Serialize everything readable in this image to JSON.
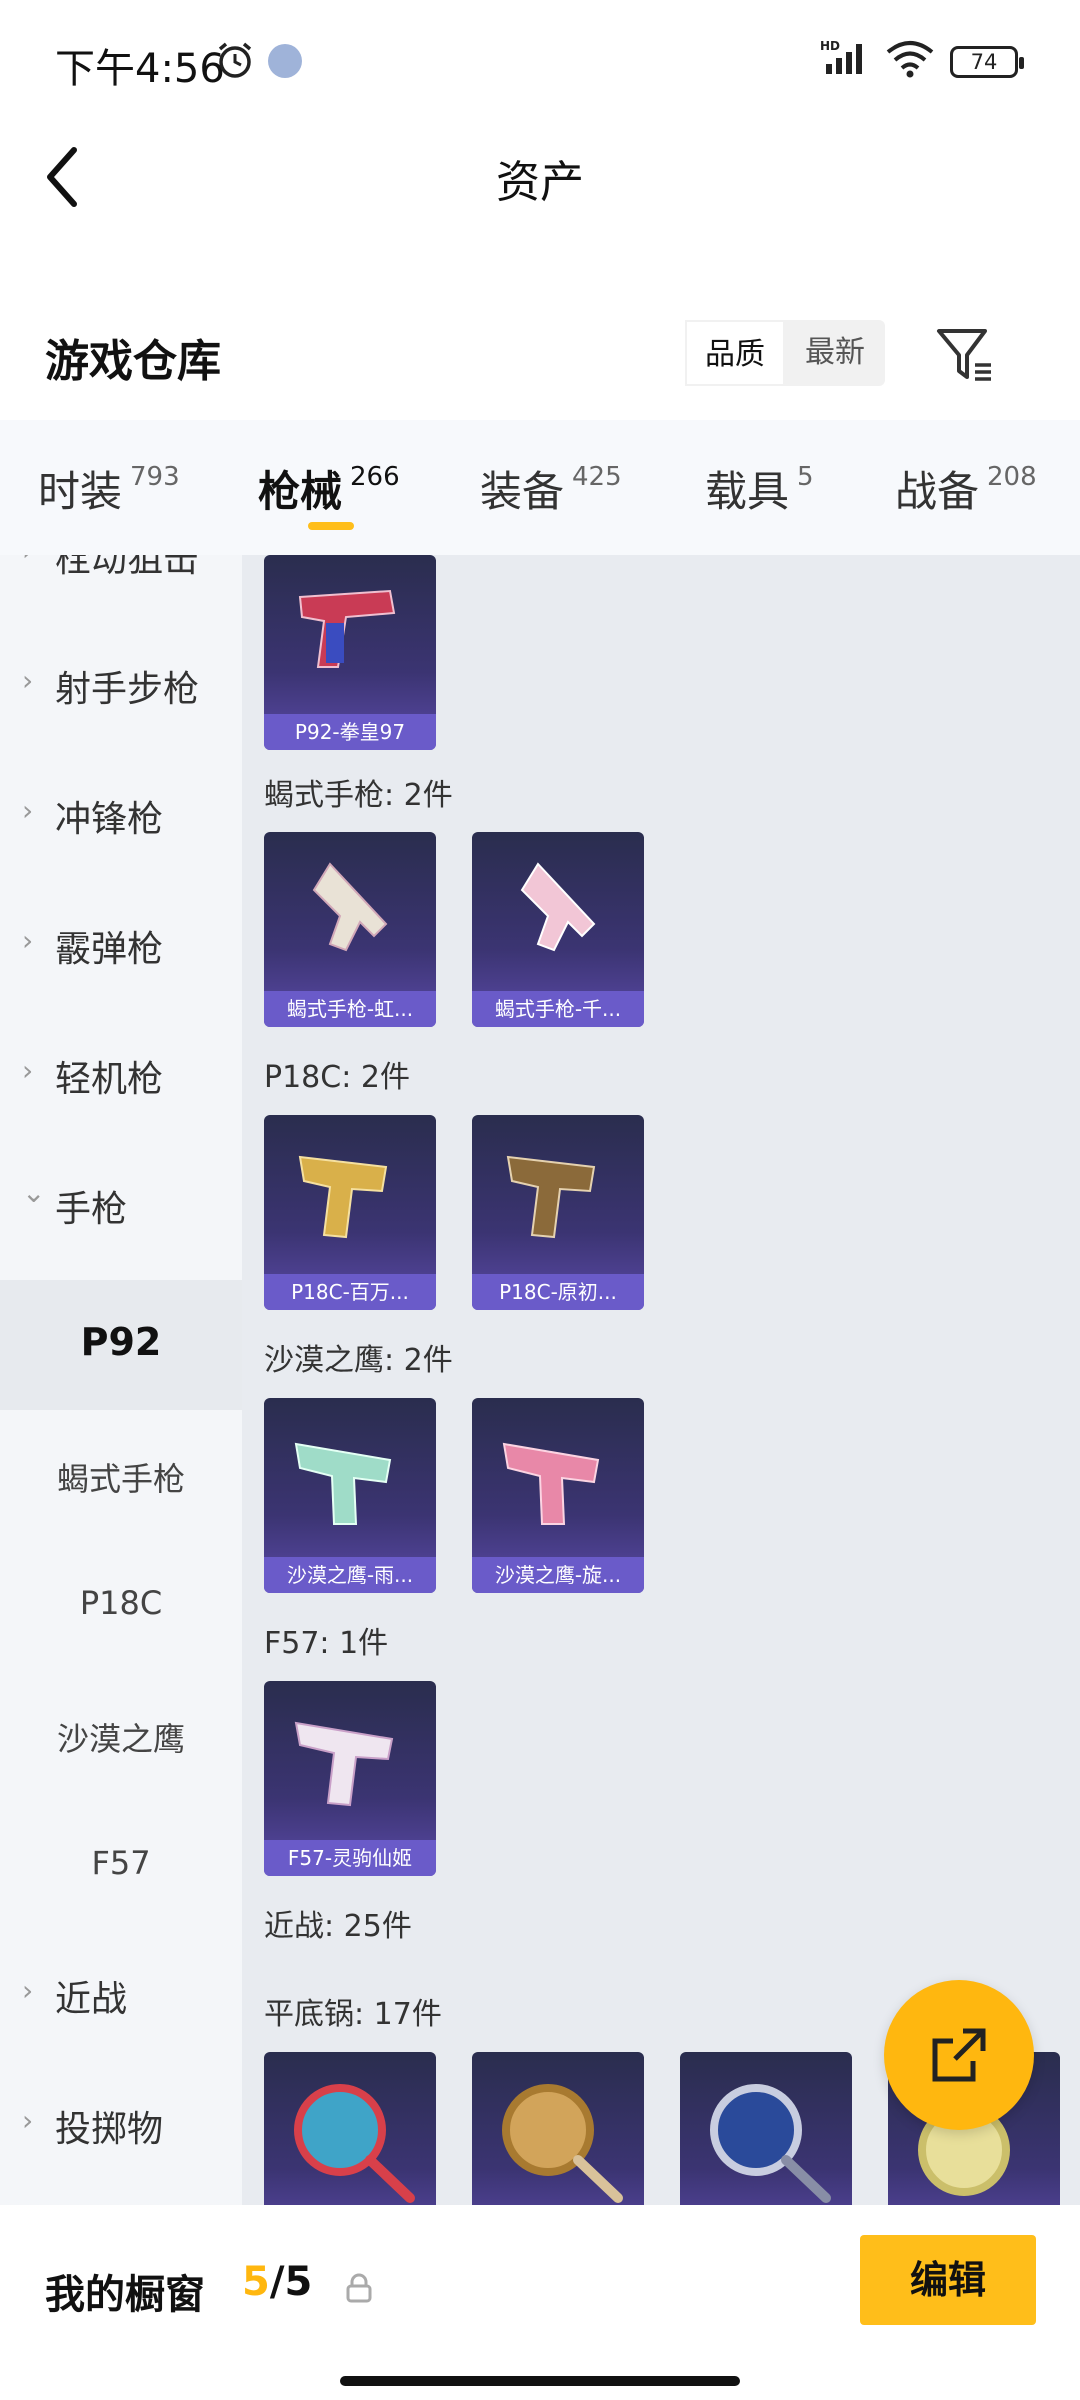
{
  "status": {
    "time": "下午4:56",
    "battery": "74"
  },
  "nav": {
    "title": "资产"
  },
  "warehouse": {
    "title": "游戏仓库"
  },
  "sort": {
    "options": [
      "品质",
      "最新"
    ],
    "selected": "品质"
  },
  "tabs": [
    {
      "label": "时装",
      "count": "793"
    },
    {
      "label": "枪械",
      "count": "266",
      "active": true
    },
    {
      "label": "装备",
      "count": "425"
    },
    {
      "label": "载具",
      "count": "5"
    },
    {
      "label": "战备",
      "count": "208"
    }
  ],
  "sidebar": {
    "items": [
      {
        "label": "栓动狙击"
      },
      {
        "label": "射手步枪"
      },
      {
        "label": "冲锋枪"
      },
      {
        "label": "霰弹枪"
      },
      {
        "label": "轻机枪"
      },
      {
        "label": "手枪",
        "expanded": true
      },
      {
        "label": "P92",
        "selected": true
      },
      {
        "label": "蝎式手枪"
      },
      {
        "label": "P18C"
      },
      {
        "label": "沙漠之鹰"
      },
      {
        "label": "F57"
      },
      {
        "label": "近战"
      },
      {
        "label": "投掷物"
      }
    ]
  },
  "content": {
    "groups": [
      {
        "title": "蝎式手枪: 2件"
      },
      {
        "title": "P18C: 2件"
      },
      {
        "title": "沙漠之鹰: 2件"
      },
      {
        "title": "F57: 1件"
      },
      {
        "title": "近战: 25件"
      },
      {
        "title": "平底锅: 17件"
      }
    ],
    "items": [
      {
        "name": "P92-拳皇97"
      },
      {
        "name": "蝎式手枪-虹..."
      },
      {
        "name": "蝎式手枪-千..."
      },
      {
        "name": "P18C-百万..."
      },
      {
        "name": "P18C-原初..."
      },
      {
        "name": "沙漠之鹰-雨..."
      },
      {
        "name": "沙漠之鹰-旋..."
      },
      {
        "name": "F57-灵驹仙姬"
      }
    ]
  },
  "bottom": {
    "label": "我的橱窗",
    "current": "5",
    "total": "/5",
    "edit_label": "编辑"
  },
  "colors": {
    "accent": "#ffbe1a",
    "card_label": "#6a5bc9",
    "content_bg": "#e8ebf0"
  }
}
